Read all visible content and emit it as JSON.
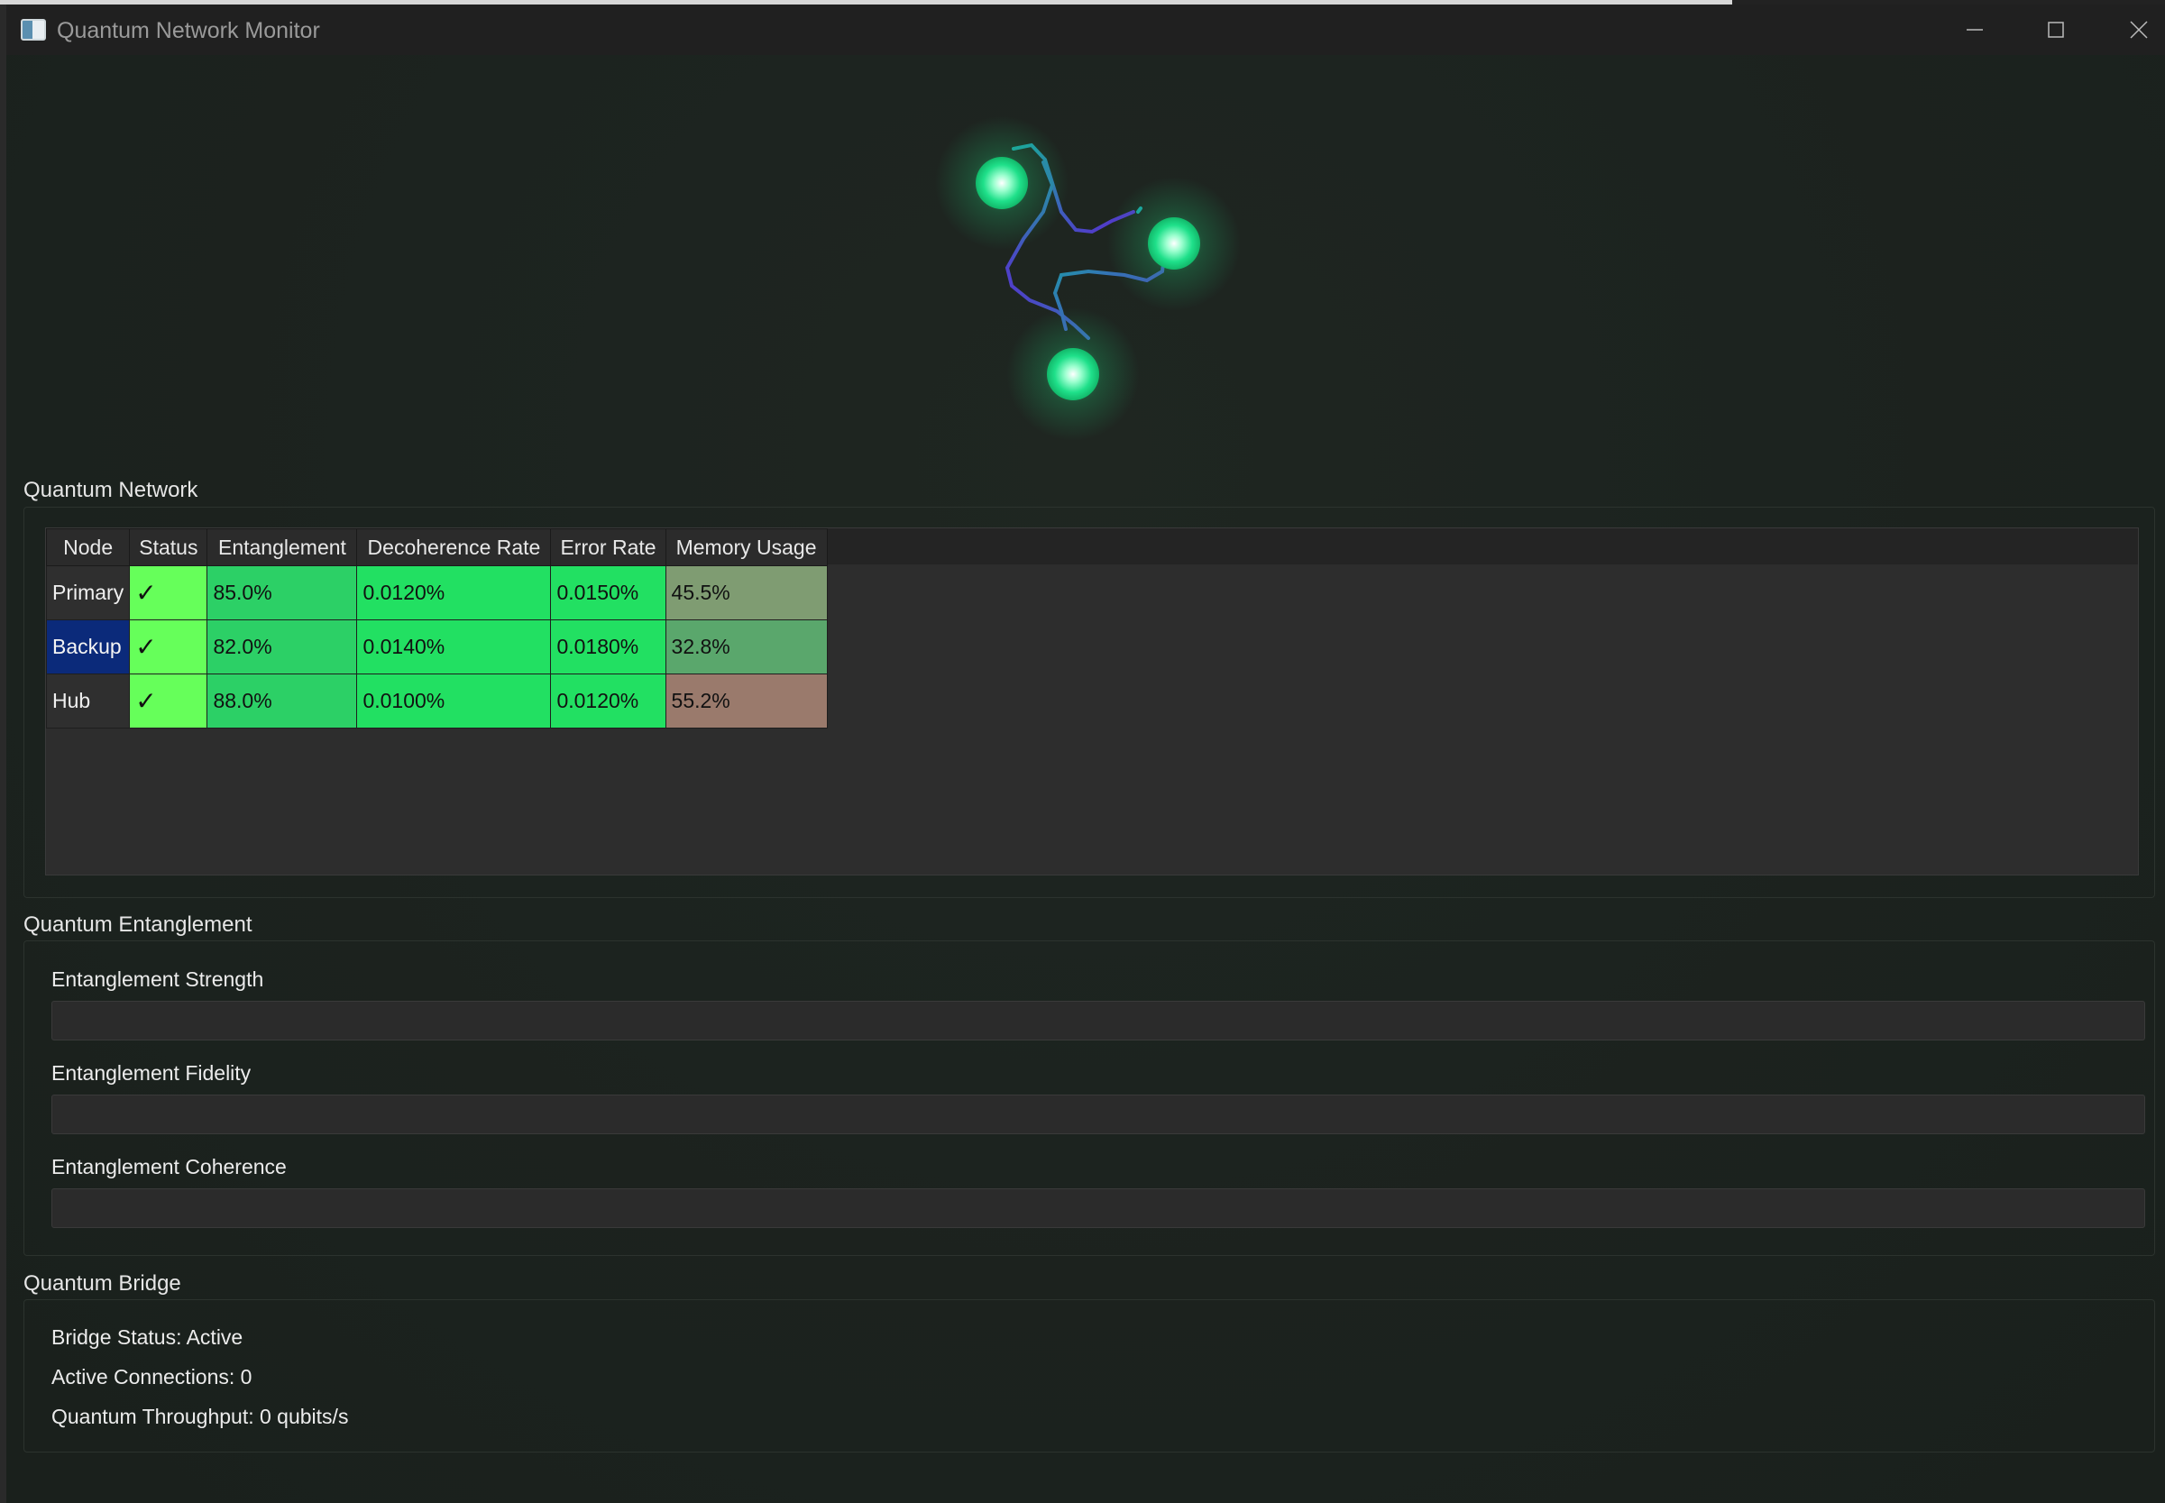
{
  "window": {
    "title": "Quantum Network Monitor",
    "controls": [
      "minimize",
      "maximize",
      "close"
    ]
  },
  "colors": {
    "accent_green": "#22e062",
    "status_green": "#66ff5a",
    "selected_blue": "#0b2a7a",
    "node_glow": "#3dffa0"
  },
  "network": {
    "title": "Quantum Network",
    "columns": [
      "Node",
      "Status",
      "Entanglement",
      "Decoherence Rate",
      "Error Rate",
      "Memory Usage"
    ],
    "rows": [
      {
        "node": "Primary",
        "status": "✓",
        "entanglement": "85.0%",
        "decoherence": "0.0120%",
        "error": "0.0150%",
        "memory": "45.5%",
        "memory_color": "#7f9c72",
        "selected": false
      },
      {
        "node": "Backup",
        "status": "✓",
        "entanglement": "82.0%",
        "decoherence": "0.0140%",
        "error": "0.0180%",
        "memory": "32.8%",
        "memory_color": "#5aa76c",
        "selected": true
      },
      {
        "node": "Hub",
        "status": "✓",
        "entanglement": "88.0%",
        "decoherence": "0.0100%",
        "error": "0.0120%",
        "memory": "55.2%",
        "memory_color": "#9a7a6c",
        "selected": false
      }
    ]
  },
  "entanglement": {
    "title": "Quantum Entanglement",
    "strength_label": "Entanglement Strength",
    "strength_value": 0,
    "fidelity_label": "Entanglement Fidelity",
    "fidelity_value": 0,
    "coherence_label": "Entanglement Coherence",
    "coherence_value": 0
  },
  "bridge": {
    "title": "Quantum Bridge",
    "status": "Bridge Status: Active",
    "connections": "Active Connections: 0",
    "throughput": "Quantum Throughput: 0 qubits/s"
  }
}
